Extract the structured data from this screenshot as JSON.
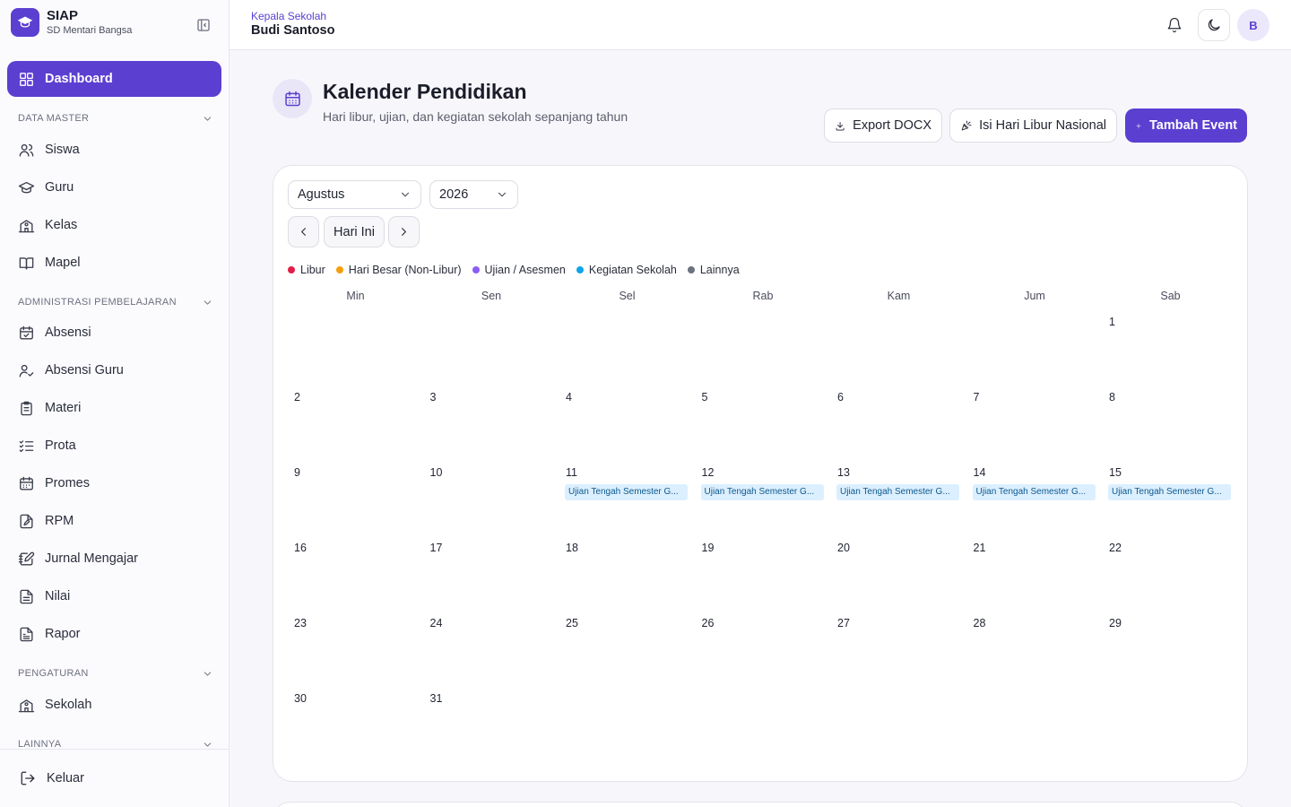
{
  "app": {
    "name": "SIAP",
    "school": "SD Mentari Bangsa"
  },
  "sidebar": {
    "dashboard": "Dashboard",
    "sections": {
      "data_master": "DATA MASTER",
      "administrasi": "ADMINISTRASI PEMBELAJARAN",
      "pengaturan": "PENGATURAN",
      "lainnya": "LAINNYA"
    },
    "items": {
      "siswa": "Siswa",
      "guru": "Guru",
      "kelas": "Kelas",
      "mapel": "Mapel",
      "absensi": "Absensi",
      "absensi_guru": "Absensi Guru",
      "materi": "Materi",
      "prota": "Prota",
      "promes": "Promes",
      "rpm": "RPM",
      "jurnal": "Jurnal Mengajar",
      "nilai": "Nilai",
      "rapor": "Rapor",
      "sekolah": "Sekolah"
    },
    "logout": "Keluar"
  },
  "header": {
    "role": "Kepala Sekolah",
    "user": "Budi Santoso",
    "avatar_initial": "B"
  },
  "page": {
    "title": "Kalender Pendidikan",
    "subtitle": "Hari libur, ujian, dan kegiatan sekolah sepanjang tahun",
    "buttons": {
      "export": "Export DOCX",
      "libur": "Isi Hari Libur Nasional",
      "tambah": "Tambah Event"
    }
  },
  "calendar": {
    "month": "Agustus",
    "year": "2026",
    "today_label": "Hari Ini",
    "legend": [
      {
        "label": "Libur",
        "color": "#e11d48"
      },
      {
        "label": "Hari Besar (Non-Libur)",
        "color": "#f59e0b"
      },
      {
        "label": "Ujian / Asesmen",
        "color": "#8b5cf6"
      },
      {
        "label": "Kegiatan Sekolah",
        "color": "#0ea5e9"
      },
      {
        "label": "Lainnya",
        "color": "#6b7280"
      }
    ],
    "weekdays": [
      "Min",
      "Sen",
      "Sel",
      "Rab",
      "Kam",
      "Jum",
      "Sab"
    ],
    "first_weekday_index": 6,
    "days_in_month": 31,
    "events": [
      {
        "day": 11,
        "title": "Ujian Tengah Semester G..."
      },
      {
        "day": 12,
        "title": "Ujian Tengah Semester G..."
      },
      {
        "day": 13,
        "title": "Ujian Tengah Semester G..."
      },
      {
        "day": 14,
        "title": "Ujian Tengah Semester G..."
      },
      {
        "day": 15,
        "title": "Ujian Tengah Semester G..."
      }
    ]
  }
}
